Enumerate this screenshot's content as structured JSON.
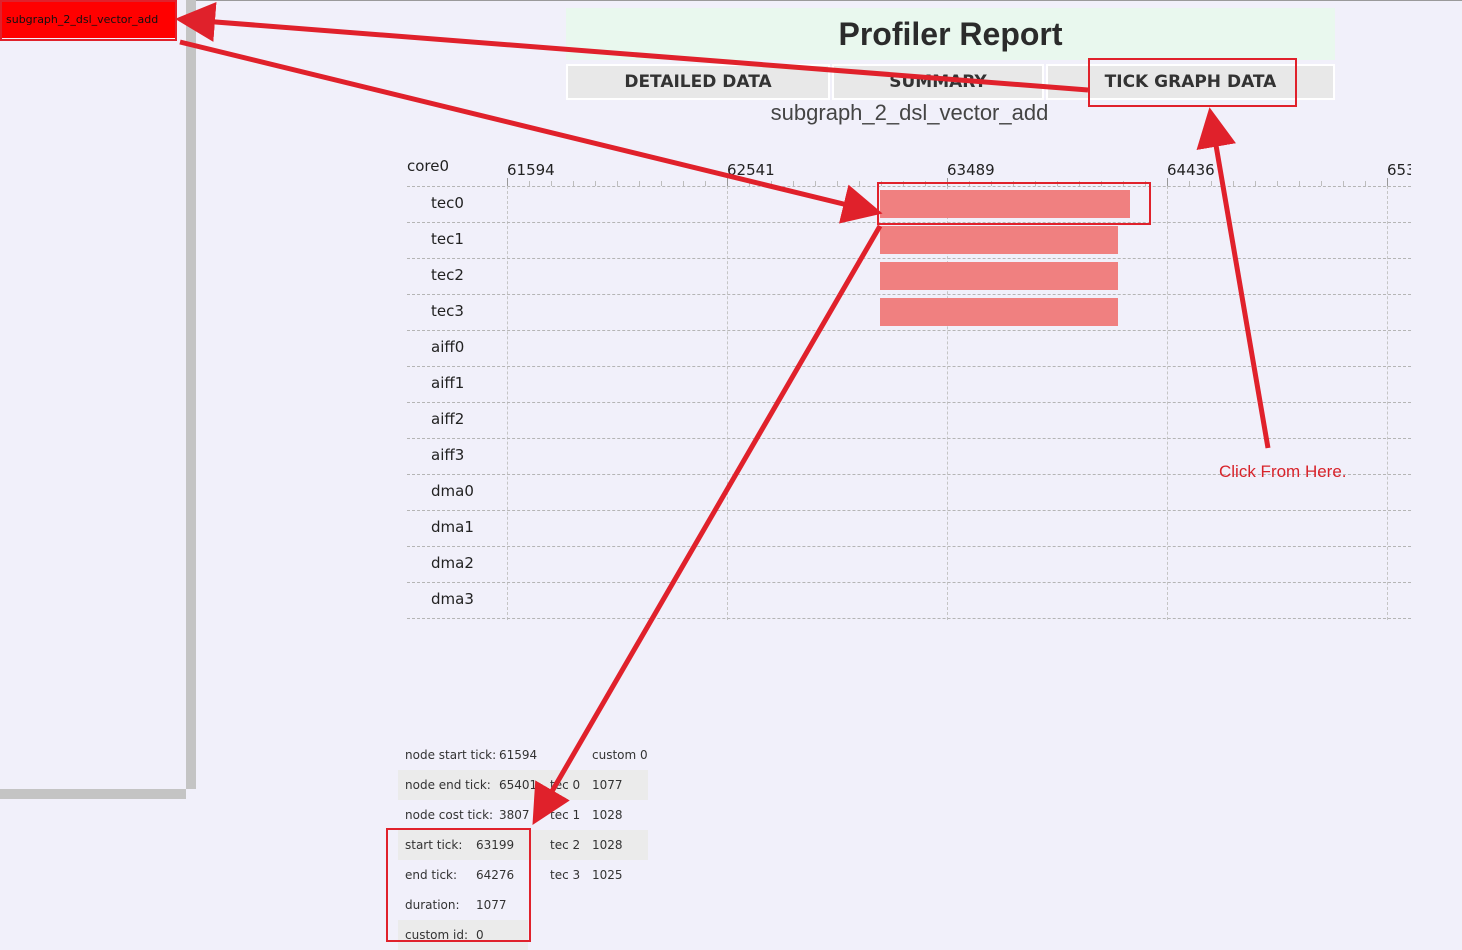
{
  "sidebar": {
    "items": [
      {
        "label": "subgraph_2_dsl_vector_add",
        "selected": true,
        "color": "#ff0000"
      }
    ]
  },
  "header": {
    "title": "Profiler Report",
    "tabs": [
      {
        "label": "DETAILED DATA"
      },
      {
        "label": "SUMMARY"
      },
      {
        "label": "TICK GRAPH DATA",
        "active": true
      }
    ],
    "subtitle": "subgraph_2_dsl_vector_add"
  },
  "tick_graph": {
    "core_label": "core0",
    "tick_labels": [
      "61594",
      "62541",
      "63489",
      "64436",
      "653"
    ],
    "rows": [
      "tec0",
      "tec1",
      "tec2",
      "tec3",
      "aiff0",
      "aiff1",
      "aiff2",
      "aiff3",
      "dma0",
      "dma1",
      "dma2",
      "dma3"
    ],
    "bar_color": "#f08080",
    "bars": [
      {
        "row": "tec0",
        "start": 63199,
        "end": 64276
      },
      {
        "row": "tec1",
        "start": 63199,
        "end": 64227
      },
      {
        "row": "tec2",
        "start": 63199,
        "end": 64227
      },
      {
        "row": "tec3",
        "start": 63199,
        "end": 64224
      }
    ]
  },
  "node_info": {
    "rows": [
      {
        "label": "node start tick:",
        "value": "61594"
      },
      {
        "label": "node end tick:",
        "value": "65401"
      },
      {
        "label": "node cost tick:",
        "value": "3807"
      }
    ]
  },
  "custom_info": {
    "header": "custom 0",
    "rows": [
      {
        "label": "tec 0",
        "value": "1077"
      },
      {
        "label": "tec 1",
        "value": "1028"
      },
      {
        "label": "tec 2",
        "value": "1028"
      },
      {
        "label": "tec 3",
        "value": "1025"
      }
    ]
  },
  "selected_info": {
    "rows": [
      {
        "label": "start tick:",
        "value": "63199"
      },
      {
        "label": "end tick:",
        "value": "64276"
      },
      {
        "label": "duration:",
        "value": "1077"
      },
      {
        "label": "custom id:",
        "value": "0"
      }
    ]
  },
  "annotation": {
    "note": "Click From Here.",
    "color": "#e0212b"
  }
}
